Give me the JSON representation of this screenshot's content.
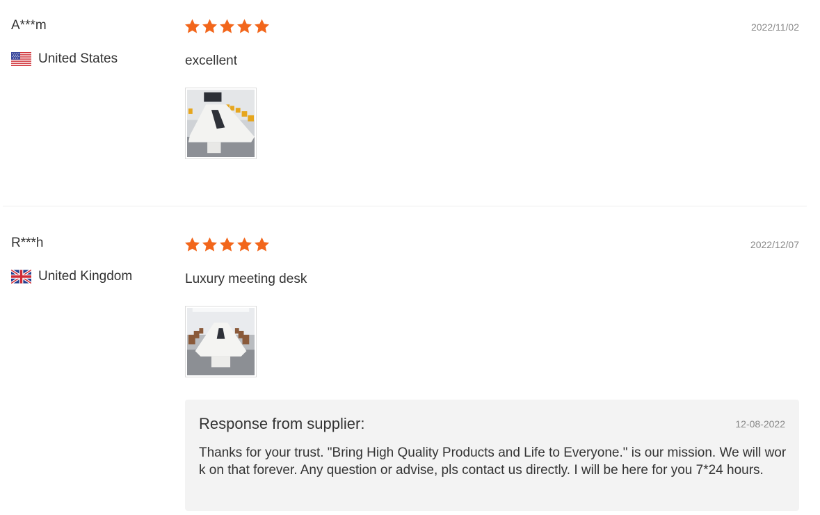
{
  "reviews": [
    {
      "username": "A***m",
      "country": "United States",
      "flag_icon": "us-flag-icon",
      "rating": 5,
      "date": "2022/11/02",
      "text": "excellent",
      "photo_icon": "conference-table-photo"
    },
    {
      "username": "R***h",
      "country": "United Kingdom",
      "flag_icon": "uk-flag-icon",
      "rating": 5,
      "date": "2022/12/07",
      "text": "Luxury meeting desk",
      "photo_icon": "meeting-room-photo",
      "response": {
        "title": "Response from supplier:",
        "date": "12-08-2022",
        "text": "Thanks for your trust. \"Bring High Quality Products and Life to Everyone.\" is our mission. We will work on that forever. Any question or advise, pls contact us directly. I will be here for you 7*24 hours."
      }
    }
  ],
  "colors": {
    "star": "#f2661b",
    "response_bg": "#f3f3f3",
    "divider": "#ececec",
    "date_text": "#888888"
  }
}
